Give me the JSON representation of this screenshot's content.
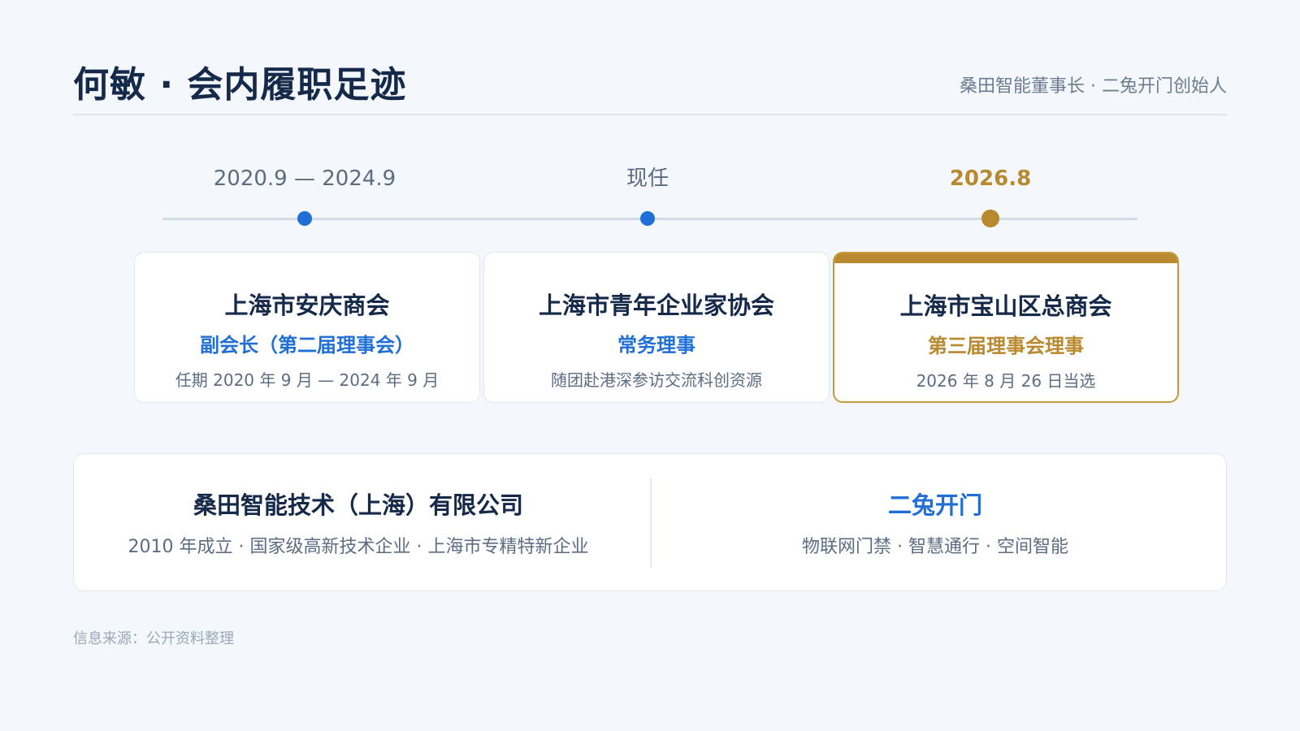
{
  "header": {
    "title": "何敏 · 会内履职足迹",
    "subtitle": "桑田智能董事长 · 二兔开门创始人"
  },
  "timeline": [
    {
      "date": "2020.9 — 2024.9",
      "highlight": false
    },
    {
      "date": "现任",
      "highlight": false
    },
    {
      "date": "2026.8",
      "highlight": true
    }
  ],
  "cards": [
    {
      "org": "上海市安庆商会",
      "role": "副会长（第二届理事会）",
      "note": "任期 2020 年 9 月 — 2024 年 9 月",
      "highlight": false
    },
    {
      "org": "上海市青年企业家协会",
      "role": "常务理事",
      "note": "随团赴港深参访交流科创资源",
      "highlight": false
    },
    {
      "org": "上海市宝山区总商会",
      "role": "第三届理事会理事",
      "note": "2026 年 8 月 26 日当选",
      "highlight": true
    }
  ],
  "companies": [
    {
      "name": "桑田智能技术（上海）有限公司",
      "desc": "2010 年成立 · 国家级高新技术企业 · 上海市专精特新企业"
    },
    {
      "name": "二兔开门",
      "desc": "物联网门禁 · 智慧通行 · 空间智能"
    }
  ],
  "footer": {
    "source": "信息来源：公开资料整理"
  },
  "colors": {
    "primary_blue": "#1f6fd6",
    "gold": "#b8892f",
    "title_navy": "#15294a",
    "background": "#f4f7fb"
  }
}
